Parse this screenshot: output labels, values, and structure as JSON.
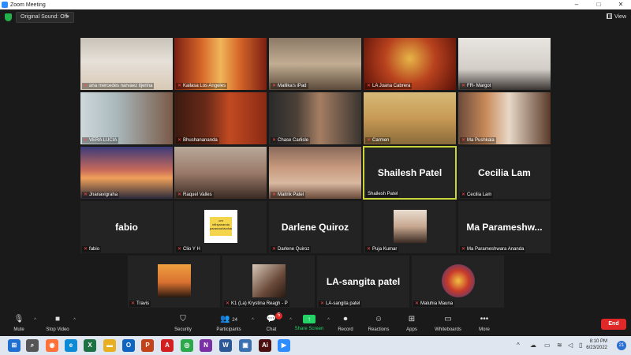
{
  "window": {
    "title": "Zoom Meeting"
  },
  "topbar": {
    "sound_label": "Original Sound: Off",
    "view_label": "View"
  },
  "tiles": [
    {
      "name": "ana mercedes narvaez tijerina",
      "muted": true
    },
    {
      "name": "Kailasa Los Angeles",
      "muted": true
    },
    {
      "name": "Mallika's iPad",
      "muted": true
    },
    {
      "name": "LA Juana Cabrera",
      "muted": true
    },
    {
      "name": "FR- Margot",
      "muted": true
    },
    {
      "name": "VERA LUCIA",
      "muted": true
    },
    {
      "name": "Bhushanananda",
      "muted": true
    },
    {
      "name": "Chase Carlisle",
      "muted": true
    },
    {
      "name": "Carmen",
      "muted": true
    },
    {
      "name": "Ma Pushkala",
      "muted": true
    },
    {
      "name": "Jnanavigraha",
      "muted": true
    },
    {
      "name": "Raquel Valles",
      "muted": true
    },
    {
      "name": "Maitrik Patel",
      "muted": true
    },
    {
      "name": "Shailesh Patel",
      "muted": false,
      "big_name": "Shailesh Patel"
    },
    {
      "name": "Cecilia Lam",
      "muted": true,
      "big_name": "Cecilia Lam"
    },
    {
      "name": "fabio",
      "muted": true,
      "big_name": "fabio"
    },
    {
      "name": "Clio Y H",
      "muted": true,
      "logo_text": "om nithyananda paramashivoham"
    },
    {
      "name": "Darlene Quiroz",
      "muted": true,
      "big_name": "Darlene Quiroz"
    },
    {
      "name": "Puja Kumar",
      "muted": true
    },
    {
      "name": "Ma Parameshwara Ananda",
      "muted": true,
      "big_name": "Ma  Parameshw..."
    },
    {
      "name": "Travis",
      "muted": true
    },
    {
      "name": "K1 (La) Krystina Reagh - P",
      "muted": true
    },
    {
      "name": "LA-sangita patel",
      "muted": true,
      "big_name": "LA-sangita patel"
    },
    {
      "name": "Maluhia Mauna",
      "muted": true
    }
  ],
  "toolbar": {
    "mute_label": "Mute",
    "video_label": "Stop Video",
    "security_label": "Security",
    "participants_label": "Participants",
    "participants_count": "24",
    "chat_label": "Chat",
    "chat_badge": "5",
    "share_label": "Share Screen",
    "record_label": "Record",
    "reactions_label": "Reactions",
    "apps_label": "Apps",
    "whiteboards_label": "Whiteboards",
    "more_label": "More",
    "end_label": "End"
  },
  "taskbar": {
    "time": "8:10 PM",
    "date": "6/23/2022",
    "notification_count": "21",
    "apps": [
      {
        "name": "windows-start",
        "glyph": "⊞",
        "color": "#1f6fd1"
      },
      {
        "name": "search",
        "glyph": "⌕",
        "color": "#555555"
      },
      {
        "name": "firefox",
        "glyph": "◉",
        "color": "#ff7139"
      },
      {
        "name": "edge",
        "glyph": "e",
        "color": "#0c8ad6"
      },
      {
        "name": "excel",
        "glyph": "X",
        "color": "#1e7145"
      },
      {
        "name": "file-explorer",
        "glyph": "▬",
        "color": "#e8b020"
      },
      {
        "name": "outlook",
        "glyph": "O",
        "color": "#0f64c0"
      },
      {
        "name": "powerpoint",
        "glyph": "P",
        "color": "#c4421a"
      },
      {
        "name": "acrobat",
        "glyph": "A",
        "color": "#d21e1e"
      },
      {
        "name": "chrome",
        "glyph": "◎",
        "color": "#2aa84a"
      },
      {
        "name": "onenote",
        "glyph": "N",
        "color": "#7b2fa5"
      },
      {
        "name": "word",
        "glyph": "W",
        "color": "#2b5797"
      },
      {
        "name": "app-misc",
        "glyph": "▣",
        "color": "#3a6fb0"
      },
      {
        "name": "illustrator",
        "glyph": "Ai",
        "color": "#4a1010"
      },
      {
        "name": "zoom",
        "glyph": "▶",
        "color": "#2d8cff"
      }
    ]
  },
  "colors": {
    "accent": "#2d8cff",
    "active_border": "#c8d43a",
    "end": "#e02828",
    "share": "#23d366"
  }
}
